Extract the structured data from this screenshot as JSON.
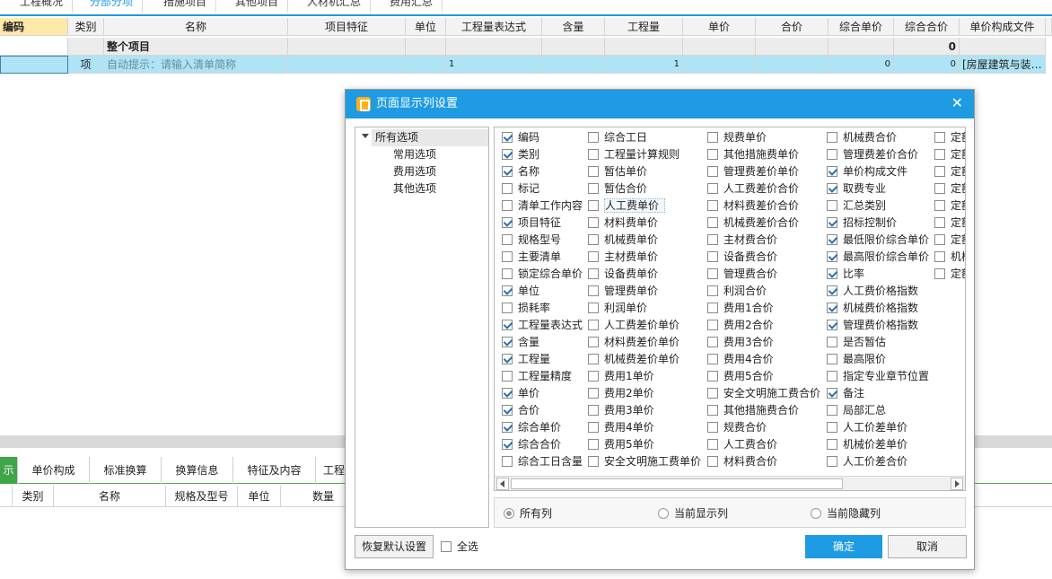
{
  "top_tabs": [
    "工程概况",
    "分部分项",
    "措施项目",
    "其他项目",
    "人材机汇总",
    "费用汇总"
  ],
  "grid": {
    "headers": [
      "编码",
      "类别",
      "名称",
      "项目特征",
      "单位",
      "工程量表达式",
      "含量",
      "工程量",
      "单价",
      "合价",
      "综合单价",
      "综合合价",
      "单价构成文件"
    ],
    "row_total": {
      "name": "整个项目",
      "total": "0"
    },
    "row_item": {
      "type": "项",
      "hint": "自动提示：请输入清单简称",
      "expr": "1",
      "qty": "1",
      "unit_total": "0",
      "total": "0",
      "file": "[房屋建筑与装…"
    }
  },
  "lower": {
    "tabs": [
      "示",
      "单价构成",
      "标准换算",
      "换算信息",
      "特征及内容",
      "工程"
    ],
    "headers": [
      "类别",
      "名称",
      "规格及型号",
      "单位",
      "数量"
    ]
  },
  "dialog": {
    "title": "页面显示列设置",
    "close": "✕",
    "tree": {
      "root": "所有选项",
      "children": [
        "常用选项",
        "费用选项",
        "其他选项"
      ]
    },
    "columns": [
      [
        {
          "label": "编码",
          "checked": true
        },
        {
          "label": "类别",
          "checked": true
        },
        {
          "label": "名称",
          "checked": true
        },
        {
          "label": "标记",
          "checked": false
        },
        {
          "label": "清单工作内容",
          "checked": false
        },
        {
          "label": "项目特征",
          "checked": true
        },
        {
          "label": "规格型号",
          "checked": false
        },
        {
          "label": "主要清单",
          "checked": false
        },
        {
          "label": "锁定综合单价",
          "checked": false
        },
        {
          "label": "单位",
          "checked": true
        },
        {
          "label": "损耗率",
          "checked": false
        },
        {
          "label": "工程量表达式",
          "checked": true
        },
        {
          "label": "含量",
          "checked": true
        },
        {
          "label": "工程量",
          "checked": true
        },
        {
          "label": "工程量精度",
          "checked": false
        },
        {
          "label": "单价",
          "checked": true
        },
        {
          "label": "合价",
          "checked": true
        },
        {
          "label": "综合单价",
          "checked": true
        },
        {
          "label": "综合合价",
          "checked": true
        },
        {
          "label": "综合工日含量",
          "checked": false
        }
      ],
      [
        {
          "label": "综合工日",
          "checked": false
        },
        {
          "label": "工程量计算规则",
          "checked": false
        },
        {
          "label": "暂估单价",
          "checked": false
        },
        {
          "label": "暂估合价",
          "checked": false
        },
        {
          "label": "人工费单价",
          "checked": false
        },
        {
          "label": "材料费单价",
          "checked": false
        },
        {
          "label": "机械费单价",
          "checked": false
        },
        {
          "label": "主材费单价",
          "checked": false
        },
        {
          "label": "设备费单价",
          "checked": false
        },
        {
          "label": "管理费单价",
          "checked": false
        },
        {
          "label": "利润单价",
          "checked": false
        },
        {
          "label": "人工费差价单价",
          "checked": false
        },
        {
          "label": "材料费差价单价",
          "checked": false
        },
        {
          "label": "机械费差价单价",
          "checked": false
        },
        {
          "label": "费用1单价",
          "checked": false
        },
        {
          "label": "费用2单价",
          "checked": false
        },
        {
          "label": "费用3单价",
          "checked": false
        },
        {
          "label": "费用4单价",
          "checked": false
        },
        {
          "label": "费用5单价",
          "checked": false
        },
        {
          "label": "安全文明施工费单价",
          "checked": false
        }
      ],
      [
        {
          "label": "规费单价",
          "checked": false
        },
        {
          "label": "其他措施费单价",
          "checked": false
        },
        {
          "label": "管理费差价单价",
          "checked": false
        },
        {
          "label": "人工费差价合价",
          "checked": false
        },
        {
          "label": "材料费差价合价",
          "checked": false
        },
        {
          "label": "机械费差价合价",
          "checked": false
        },
        {
          "label": "主材费合价",
          "checked": false
        },
        {
          "label": "设备费合价",
          "checked": false
        },
        {
          "label": "管理费合价",
          "checked": false
        },
        {
          "label": "利润合价",
          "checked": false
        },
        {
          "label": "费用1合价",
          "checked": false
        },
        {
          "label": "费用2合价",
          "checked": false
        },
        {
          "label": "费用3合价",
          "checked": false
        },
        {
          "label": "费用4合价",
          "checked": false
        },
        {
          "label": "费用5合价",
          "checked": false
        },
        {
          "label": "安全文明施工费合价",
          "checked": false
        },
        {
          "label": "其他措施费合价",
          "checked": false
        },
        {
          "label": "规费合价",
          "checked": false
        },
        {
          "label": "人工费合价",
          "checked": false
        },
        {
          "label": "材料费合价",
          "checked": false
        }
      ],
      [
        {
          "label": "机械费合价",
          "checked": false
        },
        {
          "label": "管理费差价合价",
          "checked": false
        },
        {
          "label": "单价构成文件",
          "checked": true
        },
        {
          "label": "取费专业",
          "checked": true
        },
        {
          "label": "汇总类别",
          "checked": false
        },
        {
          "label": "招标控制价",
          "checked": true
        },
        {
          "label": "最低限价综合单价",
          "checked": true
        },
        {
          "label": "最高限价综合单价",
          "checked": true
        },
        {
          "label": "比率",
          "checked": true
        },
        {
          "label": "人工费价格指数",
          "checked": true
        },
        {
          "label": "机械费价格指数",
          "checked": true
        },
        {
          "label": "管理费价格指数",
          "checked": true
        },
        {
          "label": "是否暂估",
          "checked": false
        },
        {
          "label": "最高限价",
          "checked": false
        },
        {
          "label": "指定专业章节位置",
          "checked": false
        },
        {
          "label": "备注",
          "checked": true
        },
        {
          "label": "局部汇总",
          "checked": false
        },
        {
          "label": "人工价差单价",
          "checked": false
        },
        {
          "label": "机械价差单价",
          "checked": false
        },
        {
          "label": "人工价差合价",
          "checked": false
        }
      ],
      [
        {
          "label": "定额",
          "checked": false
        },
        {
          "label": "定额",
          "checked": false
        },
        {
          "label": "定额",
          "checked": false
        },
        {
          "label": "定额",
          "checked": false
        },
        {
          "label": "定额",
          "checked": false
        },
        {
          "label": "定额",
          "checked": false
        },
        {
          "label": "定额",
          "checked": false
        },
        {
          "label": "机械",
          "checked": false
        },
        {
          "label": "定额",
          "checked": false
        }
      ]
    ],
    "radios": [
      {
        "label": "所有列",
        "selected": true
      },
      {
        "label": "当前显示列",
        "selected": false
      },
      {
        "label": "当前隐藏列",
        "selected": false
      }
    ],
    "restore_label": "恢复默认设置",
    "select_all_label": "全选",
    "ok_label": "确定",
    "cancel_label": "取消"
  }
}
